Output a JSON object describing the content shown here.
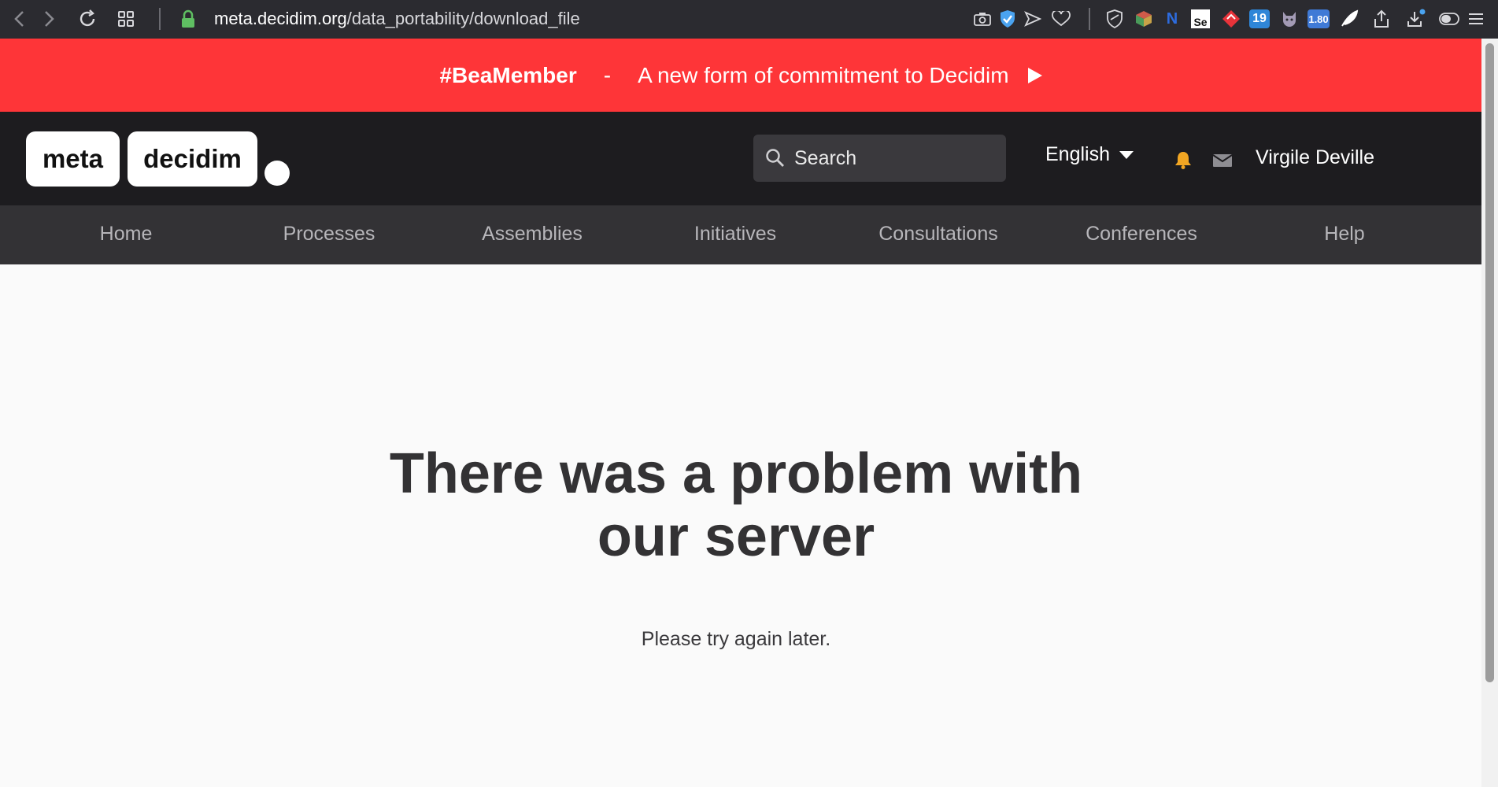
{
  "browser": {
    "url_host": "meta.decidim.org",
    "url_path": "/data_portability/download_file",
    "icons": [
      "back-icon",
      "forward-icon",
      "reload-icon",
      "tabs-grid-icon",
      "lock-icon",
      "camera-icon",
      "shield-check-icon",
      "send-icon",
      "heart-icon",
      "shield-icon",
      "cube-icon",
      "n-extension-icon",
      "se-extension-icon",
      "diamond-extension-icon",
      "counter-extension-icon",
      "cat-extension-icon",
      "speed-extension-icon",
      "feather-icon",
      "share-icon",
      "download-icon",
      "toggle-icon",
      "menu-icon"
    ],
    "ext_counter_label": "19",
    "ext_speed_label": "1.80",
    "ext_n_label": "N",
    "ext_se_label": "Se"
  },
  "banner": {
    "tag": "#BeaMember",
    "dash": "-",
    "text": "A new form of commitment to Decidim",
    "color": "#fe3538"
  },
  "header": {
    "logo_left": "meta",
    "logo_right": "decidim",
    "search_placeholder": "Search",
    "language": "English",
    "user_name": "Virgile Deville",
    "bell_color": "#f2a623"
  },
  "nav": {
    "items": [
      "Home",
      "Processes",
      "Assemblies",
      "Initiatives",
      "Consultations",
      "Conferences",
      "Help"
    ]
  },
  "error": {
    "title": "There was a problem with our server",
    "message": "Please try again later."
  }
}
